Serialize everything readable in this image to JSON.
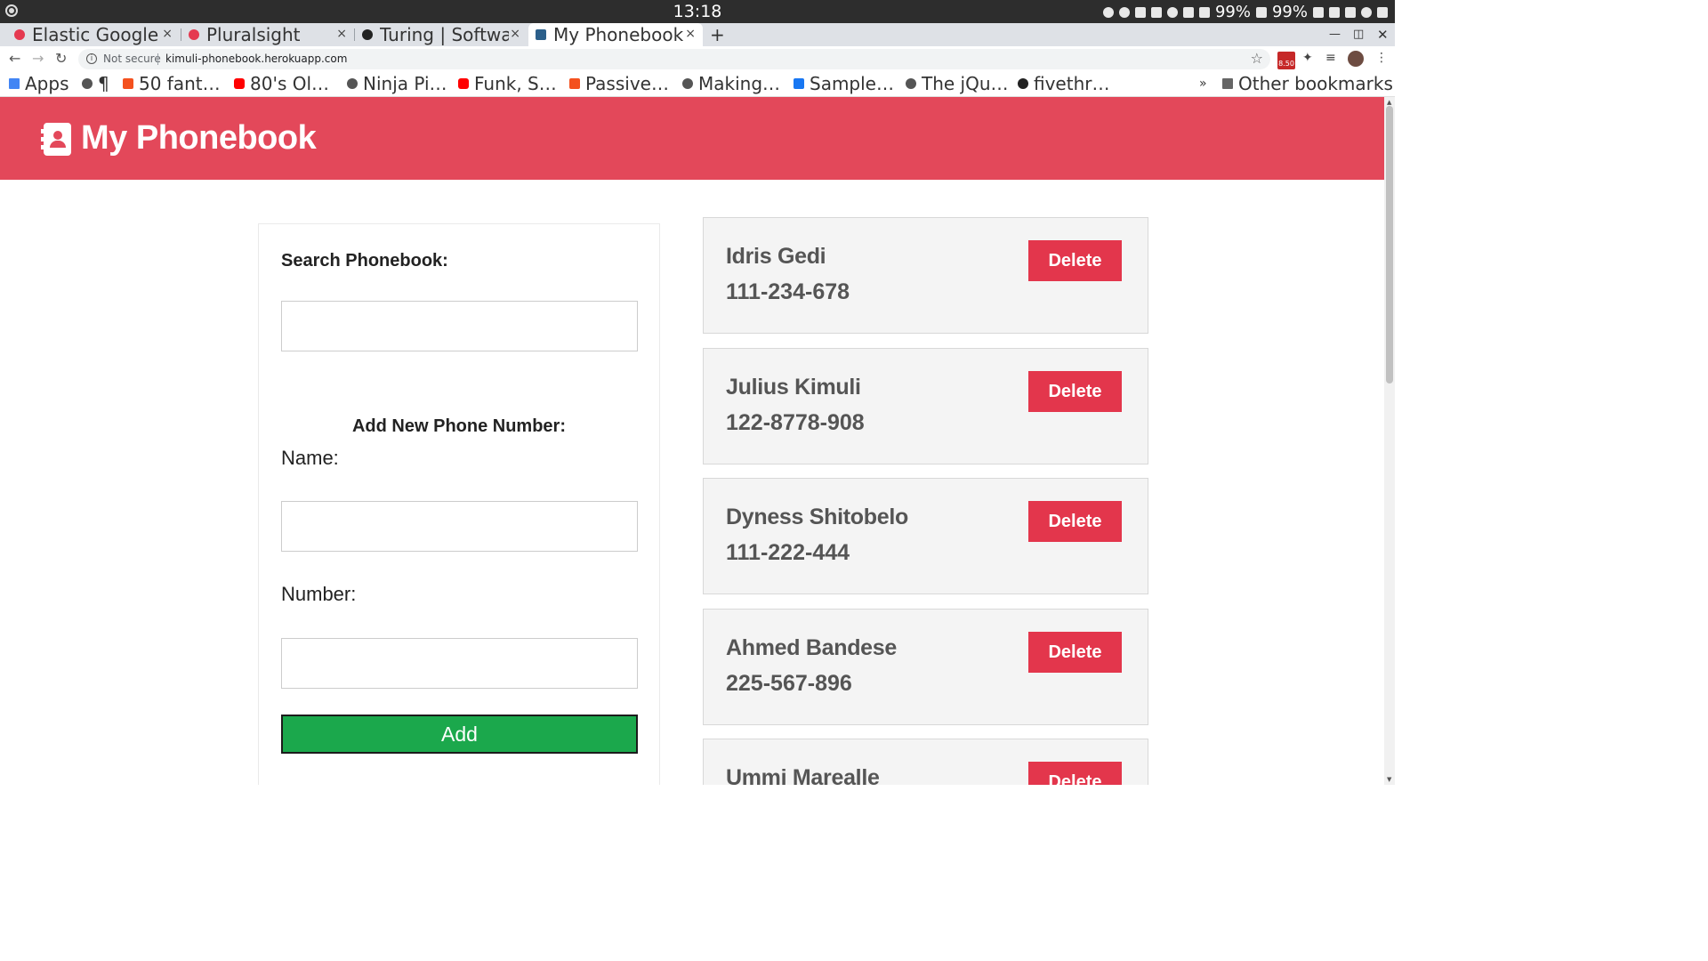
{
  "os": {
    "clock": "13:18",
    "battery_a": "99%",
    "battery_b": "99%"
  },
  "tabs": [
    {
      "title": "Elastic Google (",
      "favicon_color": "#e53950",
      "active": false
    },
    {
      "title": "Pluralsight",
      "favicon_color": "#e53950",
      "active": false
    },
    {
      "title": "Turing | Softwa",
      "favicon_color": "#222222",
      "active": false
    },
    {
      "title": "My Phonebook",
      "favicon_color": "#2b5f8a",
      "active": true
    }
  ],
  "tab_close": "×",
  "new_tab": "+",
  "address": {
    "security": "Not secure",
    "url": "kimuli-phonebook.herokuapp.com"
  },
  "ext_badge": "8.50",
  "bookmarks": [
    {
      "label": "Apps",
      "icon_color": "#4285f4"
    },
    {
      "label": "¶",
      "icon_color": "#555555"
    },
    {
      "label": "50 fant…",
      "icon_color": "#f4511e"
    },
    {
      "label": "80's Ol…",
      "icon_color": "#ff0000"
    },
    {
      "label": "Ninja Pi…",
      "icon_color": "#555555"
    },
    {
      "label": "Funk, S…",
      "icon_color": "#ff0000"
    },
    {
      "label": "Passive…",
      "icon_color": "#f4511e"
    },
    {
      "label": "Making…",
      "icon_color": "#555555"
    },
    {
      "label": "Sample…",
      "icon_color": "#1877f2"
    },
    {
      "label": "The jQu…",
      "icon_color": "#555555"
    },
    {
      "label": "fivethr…",
      "icon_color": "#222222"
    }
  ],
  "bookmarks_overflow": "»",
  "other_bookmarks": "Other bookmarks",
  "app": {
    "title": "My Phonebook",
    "header_color": "#e3485a"
  },
  "form": {
    "search_label": "Search Phonebook:",
    "search_value": "",
    "add_heading": "Add New Phone Number:",
    "name_label": "Name:",
    "name_value": "",
    "number_label": "Number:",
    "number_value": "",
    "add_button": "Add"
  },
  "contacts": [
    {
      "name": "Idris Gedi",
      "phone": "111-234-678",
      "delete_label": "Delete"
    },
    {
      "name": "Julius Kimuli",
      "phone": "122-8778-908",
      "delete_label": "Delete"
    },
    {
      "name": "Dyness Shitobelo",
      "phone": "111-222-444",
      "delete_label": "Delete"
    },
    {
      "name": "Ahmed Bandese",
      "phone": "225-567-896",
      "delete_label": "Delete"
    },
    {
      "name": "Ummi Marealle",
      "phone": "",
      "delete_label": "Delete"
    }
  ]
}
